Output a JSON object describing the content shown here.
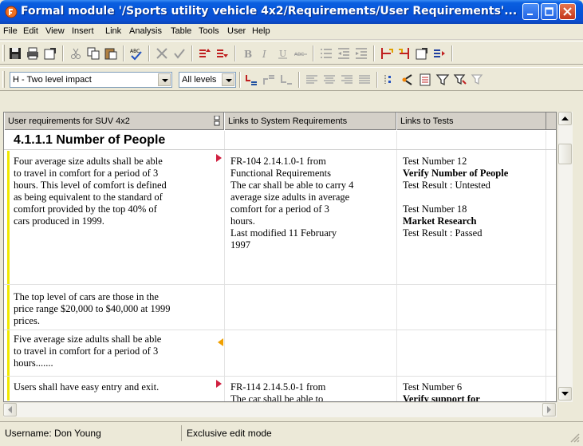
{
  "window": {
    "title": "Formal module '/Sports utility vehicle 4x2/Requirements/User Requirements'..."
  },
  "menu": [
    "File",
    "Edit",
    "View",
    "Insert",
    "Link",
    "Analysis",
    "Table",
    "Tools",
    "User",
    "Help"
  ],
  "toolbar2": {
    "view_combo": "H - Two level impact",
    "levels_combo": "All levels"
  },
  "grid": {
    "columns": [
      "User requirements for SUV 4x2",
      "Links to System Requirements",
      "Links to Tests"
    ],
    "heading": "4.1.1.1 Number of People",
    "rows": [
      {
        "req": [
          "Four average size adults shall be able",
          "to travel in comfort for a period of 3",
          "hours. This level of comfort is defined",
          "as being equivalent to the standard of",
          "comfort provided by the top 40% of",
          "cars produced in 1999."
        ],
        "sys": [
          "FR-104  2.14.1.0-1 from",
          "Functional Requirements",
          "The car shall be able to carry 4",
          "average size adults in average",
          "comfort for a period of 3",
          "hours.",
          "Last modified 11 February",
          "1997"
        ],
        "tests": [
          {
            "text": "Test Number 12",
            "bold": false
          },
          {
            "text": "Verify Number of People",
            "bold": true
          },
          {
            "text": "Test Result : Untested",
            "bold": false
          },
          {
            "text": "",
            "bold": false
          },
          {
            "text": "Test Number 18",
            "bold": false
          },
          {
            "text": "Market Research",
            "bold": true
          },
          {
            "text": "Test Result : Passed",
            "bold": false
          }
        ]
      },
      {
        "req": [
          "The top level of cars are those in the",
          "price range $20,000 to $40,000 at 1999",
          "prices."
        ],
        "sys": [],
        "tests": []
      },
      {
        "req": [
          "Five average size adults shall be able",
          "to travel in comfort for a period of 3",
          "hours......."
        ],
        "sys": [],
        "tests": []
      },
      {
        "req": [
          "Users shall have easy entry and exit."
        ],
        "sys": [
          "FR-114  2.14.5.0-1 from",
          "The car shall be able to"
        ],
        "tests": [
          {
            "text": "Test Number 6",
            "bold": false
          },
          {
            "text": "Verify support for",
            "bold": true
          }
        ]
      }
    ]
  },
  "status": {
    "username": "Username: Don Young",
    "mode": "Exclusive edit mode"
  },
  "colors": {
    "title_bar": "#0654d8",
    "change_bar": "#f0e800",
    "link_out": "#d02040",
    "link_in": "#f0a000"
  }
}
